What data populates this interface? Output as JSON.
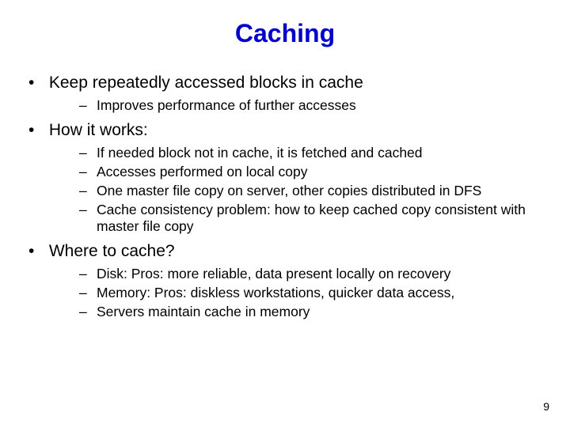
{
  "title": "Caching",
  "bullets": [
    {
      "text": "Keep repeatedly accessed blocks in cache",
      "sub": [
        "Improves performance of further accesses"
      ]
    },
    {
      "text": "How it works:",
      "sub": [
        "If needed block not in cache, it is fetched and cached",
        "Accesses performed on local copy",
        "One master file copy on server, other copies distributed in DFS",
        "Cache consistency problem: how to keep cached copy consistent with master file copy"
      ]
    },
    {
      "text": "Where to cache?",
      "sub": [
        "Disk: Pros: more reliable, data present locally on recovery",
        "Memory: Pros: diskless workstations, quicker data access,",
        "Servers maintain cache in memory"
      ]
    }
  ],
  "page_number": "9"
}
